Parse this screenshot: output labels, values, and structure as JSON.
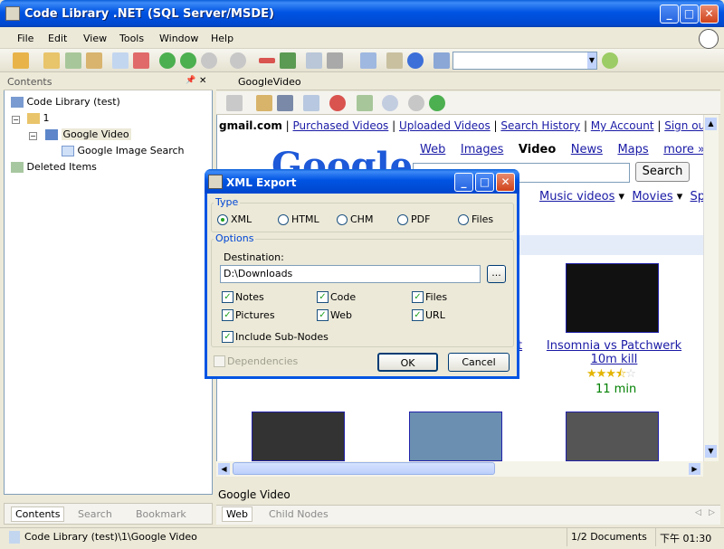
{
  "window": {
    "title": "Code Library .NET (SQL Server/MSDE)",
    "minimize": "_",
    "maximize": "□",
    "close": "✕"
  },
  "menu": [
    "File",
    "Edit",
    "View",
    "Tools",
    "Window",
    "Help"
  ],
  "left_pane": {
    "header": "Contents",
    "pin": "📌",
    "close": "✕",
    "tree": [
      {
        "label": "Code Library (test)",
        "icon": "database-icon"
      },
      {
        "label": "1",
        "icon": "folder-icon"
      },
      {
        "label": "Google Video",
        "icon": "node-icon",
        "selected": true
      },
      {
        "label": "Google Image Search",
        "icon": "page-icon"
      },
      {
        "label": "Deleted Items",
        "icon": "recycle-bin-icon"
      }
    ],
    "tabs": [
      "Contents",
      "Search",
      "Bookmark"
    ]
  },
  "right_pane": {
    "doc_tab": "GoogleVideo",
    "page_name": "Google Video",
    "tabs": [
      "Web",
      "Child Nodes"
    ]
  },
  "web": {
    "toplinks": {
      "bold": "gmail.com",
      "links": [
        "Purchased Videos",
        "Uploaded Videos",
        "Search History",
        "My Account",
        "Sign out"
      ]
    },
    "nav": [
      "Web",
      "Images",
      "Video",
      "News",
      "Maps",
      "more »"
    ],
    "logo": "Google",
    "search_button": "Search",
    "categories": [
      "Music videos",
      "Movies",
      "Spo"
    ],
    "video_title": "Insomnia vs Patchwerk 10m kill",
    "video_title_lines": [
      "Insomnia vs Patchwerk",
      "10m kill"
    ],
    "video_duration": "11 min",
    "video_rating": 3.5,
    "partial_text": "t"
  },
  "dialog": {
    "title": "XML Export",
    "type_label": "Type",
    "types": [
      "XML",
      "HTML",
      "CHM",
      "PDF",
      "Files"
    ],
    "selected_type": "XML",
    "options_label": "Options",
    "destination_label": "Destination:",
    "destination_value": "D:\\Downloads",
    "browse": "...",
    "checkboxes": [
      {
        "label": "Notes",
        "checked": true
      },
      {
        "label": "Code",
        "checked": true
      },
      {
        "label": "Files",
        "checked": true
      },
      {
        "label": "Pictures",
        "checked": true
      },
      {
        "label": "Web",
        "checked": true
      },
      {
        "label": "URL",
        "checked": true
      }
    ],
    "include_subnodes": "Include Sub-Nodes",
    "dependencies": "Dependencies",
    "ok": "OK",
    "cancel": "Cancel"
  },
  "status": {
    "path": "Code Library (test)\\1\\Google Video",
    "docs": "1/2 Documents",
    "time": "下午 01:30"
  }
}
